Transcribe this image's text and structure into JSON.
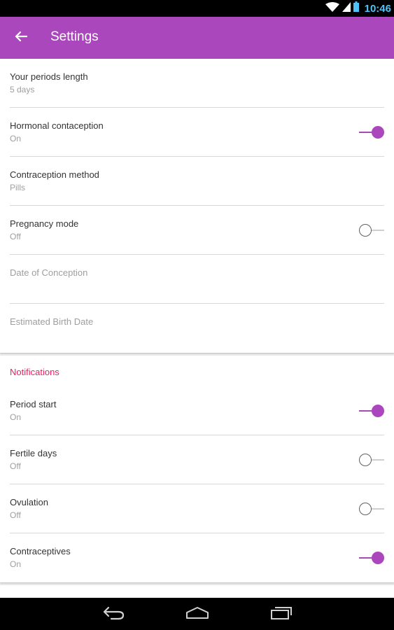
{
  "status_bar": {
    "time": "10:46"
  },
  "toolbar": {
    "title": "Settings",
    "back_icon": "arrow-left-icon"
  },
  "colors": {
    "accent": "#ab47bc",
    "section_header": "#e91e63",
    "secondary_text": "#9e9e9e"
  },
  "general": {
    "items": [
      {
        "title": "Your periods length",
        "value": "5 days"
      },
      {
        "title": "Hormonal contaception",
        "value": "On",
        "toggle": true
      },
      {
        "title": "Contraception method",
        "value": "Pills"
      },
      {
        "title": "Pregnancy mode",
        "value": "Off",
        "toggle": false
      },
      {
        "title": "Date of Conception"
      },
      {
        "title": "Estimated Birth Date"
      }
    ]
  },
  "notifications": {
    "header": "Notifications",
    "items": [
      {
        "title": "Period start",
        "value": "On",
        "toggle": true
      },
      {
        "title": "Fertile days",
        "value": "Off",
        "toggle": false
      },
      {
        "title": "Ovulation",
        "value": "Off",
        "toggle": false
      },
      {
        "title": "Contraceptives",
        "value": "On",
        "toggle": true
      }
    ]
  },
  "nav_bar": {
    "icons": [
      "back-icon",
      "home-icon",
      "recents-icon"
    ]
  }
}
